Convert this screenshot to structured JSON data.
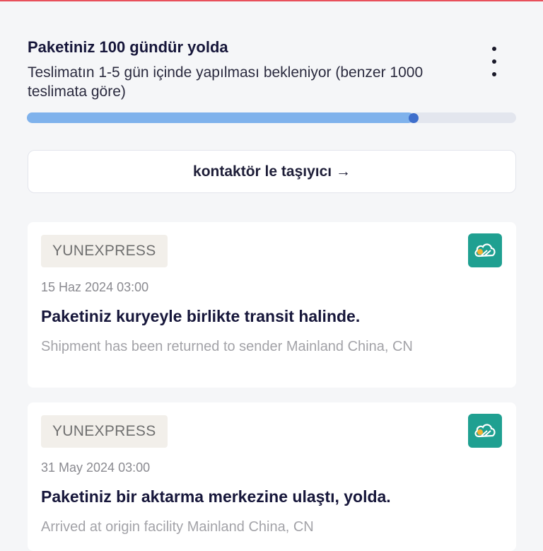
{
  "colors": {
    "accent_top": "#e8505b",
    "progress_fill": "#7fb2ec",
    "progress_knob": "#3f6fcc",
    "carrier_logo_bg": "#1fa091"
  },
  "status": {
    "title": "Paketiniz 100 gündür yolda",
    "subtitle": "Teslimatın 1-5 gün içinde yapılması bekleniyor (benzer 1000 teslimata göre)",
    "progress_fraction": 0.79,
    "more_icon": "more-vertical-icon"
  },
  "contact_button": {
    "label": "kontaktör le taşıyıcı →"
  },
  "events": [
    {
      "carrier": "YUNEXPRESS",
      "date": "15 Haz 2024 03:00",
      "title": "Paketiniz kuryeyle birlikte transit halinde.",
      "detail": "Shipment has been returned to sender Mainland China, CN",
      "logo_icon": "cloud-logo-icon"
    },
    {
      "carrier": "YUNEXPRESS",
      "date": "31 May 2024 03:00",
      "title": "Paketiniz bir aktarma merkezine ulaştı, yolda.",
      "detail": "Arrived at origin facility Mainland China, CN",
      "logo_icon": "cloud-logo-icon"
    }
  ]
}
